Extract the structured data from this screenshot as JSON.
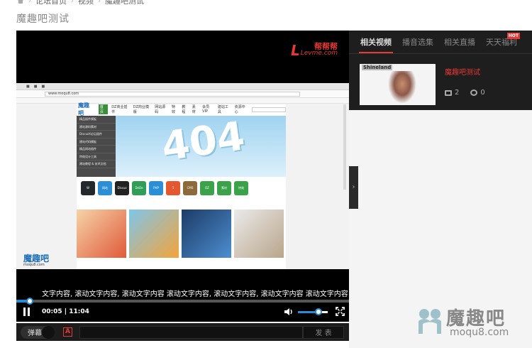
{
  "breadcrumb": {
    "items": [
      "论坛首页",
      "视频",
      "魔趣吧测试"
    ]
  },
  "page": {
    "title": "魔趣吧测试"
  },
  "player": {
    "brand_name": "帮帮帮",
    "brand_url": "Levme.com",
    "brand_mark": "L",
    "screen": {
      "address_bar": "www.moqu8.com",
      "site_logo": "魔趣吧",
      "site_nav": [
        "首页",
        "DZ商业插件",
        "DZ商业模版",
        "网站源码",
        "特效",
        "教程",
        "素材",
        "会员VIP",
        "建站工具",
        "资源中心"
      ],
      "side_menu": [
        "精品插件模板",
        "建站源码素材",
        "DiscuzX论坛插件",
        "建站代码模板",
        "精品网站插件",
        "特效设计工具",
        "建站教程 & 技术文档"
      ],
      "banner_text": "404",
      "app_icons": [
        {
          "name": "wordpress",
          "color": "#23282d",
          "label": "W"
        },
        {
          "name": "discuz",
          "color": "#2a8fd6",
          "label": "网站"
        },
        {
          "name": "discuz-x",
          "color": "#222222",
          "label": "Discuz"
        },
        {
          "name": "dede",
          "color": "#2e9e58",
          "label": "DeDe"
        },
        {
          "name": "phpcms",
          "color": "#2a8fd6",
          "label": "PHP"
        },
        {
          "name": "html5",
          "color": "#e5572e",
          "label": "5"
        },
        {
          "name": "cms",
          "color": "#8c6a3a",
          "label": "CMS"
        },
        {
          "name": "template",
          "color": "#3aa34a",
          "label": "DZ"
        },
        {
          "name": "material",
          "color": "#3aa34a",
          "label": "素材"
        },
        {
          "name": "special",
          "color": "#3aa34a",
          "label": "特效"
        }
      ],
      "logo_overlay": "魔趣吧",
      "logo_overlay_url": "moqu8.com"
    },
    "subtitle": "文字内容, 滚动文字内容, 滚动文字内容   滚动文字内容, 滚动文字内容, 滚动文字内容   滚动文字内容",
    "progress_fraction": 0.0075,
    "current_time": "00:05",
    "duration": "11:04",
    "time_display": "00:05 | 11:04",
    "volume_fraction": 0.7,
    "danmu_label": "弹幕",
    "danmu_input_placeholder": "",
    "send_label": "发 表",
    "style_icon_label": "A"
  },
  "panel": {
    "tabs": [
      {
        "label": "相关视频",
        "active": true
      },
      {
        "label": "播音选集",
        "active": false
      },
      {
        "label": "相关直播",
        "active": false
      },
      {
        "label": "天天福利",
        "active": false
      }
    ],
    "hot_badge": "HOT",
    "related": [
      {
        "thumbnail_label": "Shineland",
        "title": "魔趣吧测试",
        "comments": "2",
        "chats": "0"
      }
    ]
  },
  "watermark": {
    "text": "魔趣吧",
    "url": "moqu8.com"
  },
  "colors": {
    "accent": "#e53935",
    "progress": "#2a8cd6"
  }
}
